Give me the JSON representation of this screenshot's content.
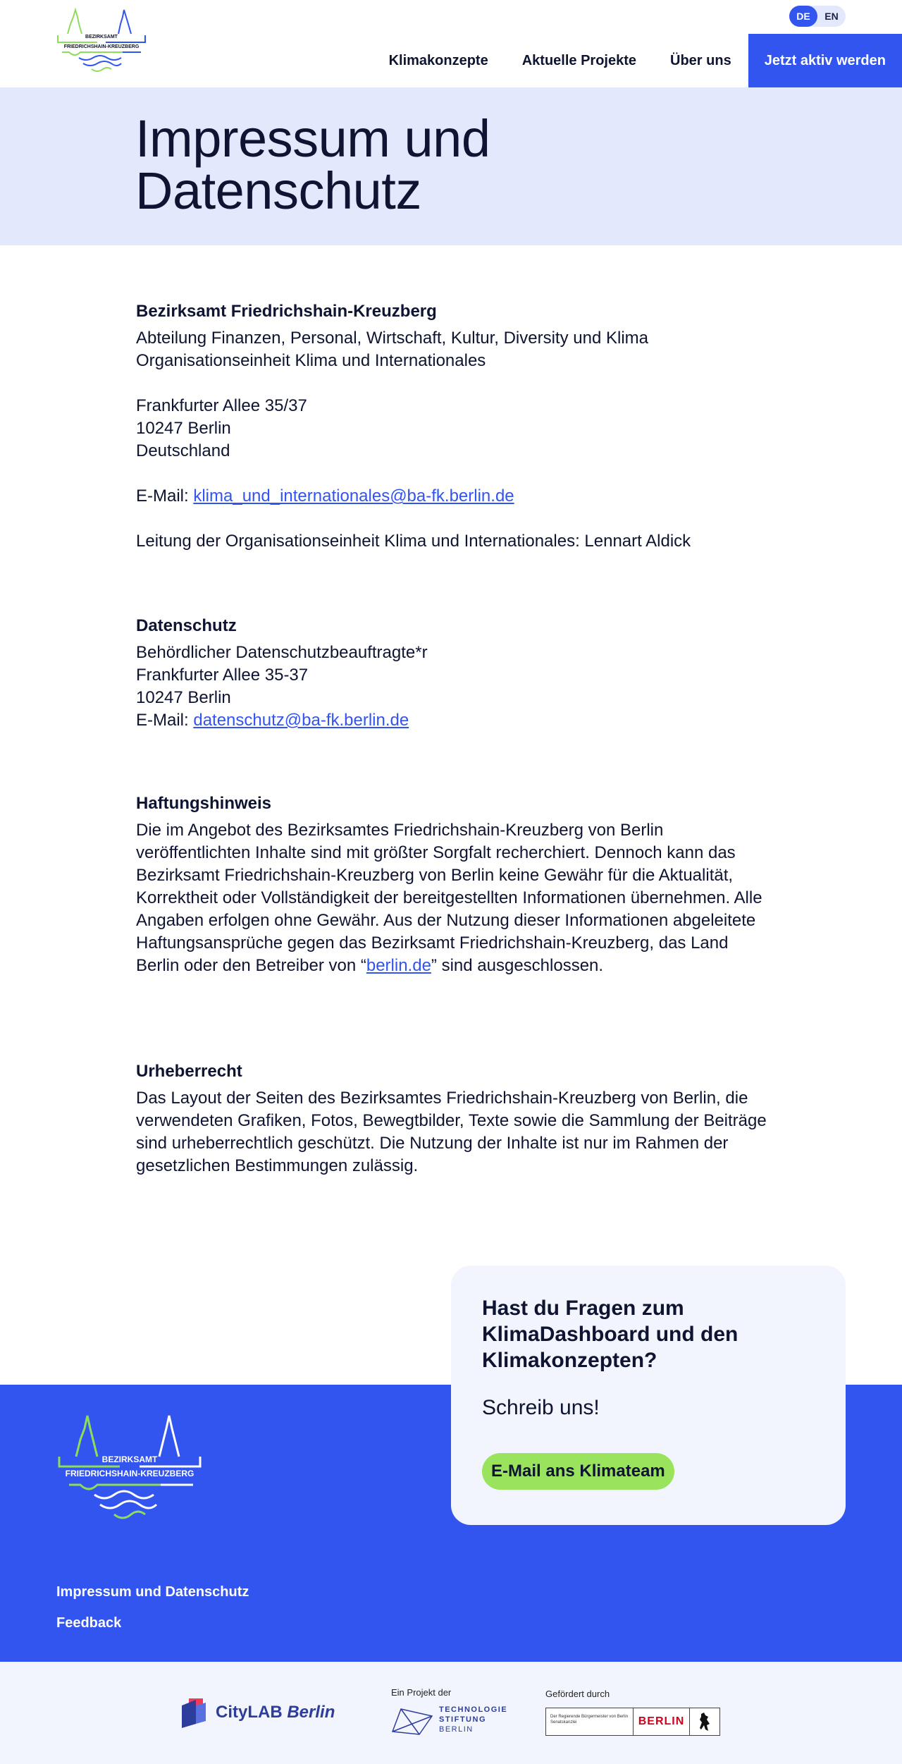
{
  "header": {
    "logo_alt_line1": "BEZIRKSAMT",
    "logo_alt_line2": "FRIEDRICHSHAIN-KREUZBERG",
    "lang": [
      "DE",
      "EN"
    ],
    "nav": [
      "Klimakonzepte",
      "Aktuelle Projekte",
      "Über uns"
    ],
    "cta": "Jetzt aktiv werden"
  },
  "page_title": "Impressum und Datenschutz",
  "impressum": {
    "heading": "Bezirksamt Friedrichshain-Kreuzberg",
    "dept1": "Abteilung Finanzen, Personal, Wirtschaft, Kultur, Diversity und Klima",
    "dept2": "Organisationseinheit Klima und Internationales",
    "street": "Frankfurter Allee 35/37",
    "city": "10247 Berlin",
    "country": "Deutschland",
    "email_label": "E-Mail: ",
    "email": "klima_und_internationales@ba-fk.berlin.de",
    "leitung": "Leitung der Organisationseinheit Klima und Internationales: Lennart Aldick"
  },
  "datenschutz": {
    "heading": "Datenschutz",
    "line1": "Behördlicher Datenschutzbeauftragte*r",
    "line2": "Frankfurter Allee 35-37",
    "line3": "10247 Berlin",
    "email_label": "E-Mail: ",
    "email": "datenschutz@ba-fk.berlin.de"
  },
  "haftung": {
    "heading": "Haftungshinweis",
    "text_before": "Die im Angebot des Bezirksamtes Friedrichshain-Kreuzberg von Berlin veröffentlichten Inhalte sind mit größter Sorgfalt recherchiert. Dennoch kann das Bezirksamt Friedrichshain-Kreuzberg von Berlin keine Gewähr für die Aktualität, Korrektheit oder Vollständigkeit der bereitgestellten Informationen übernehmen. Alle Angaben erfolgen ohne Gewähr. Aus der Nutzung dieser Informationen abgeleitete Haftungsansprüche gegen das Bezirksamt Friedrichshain-Kreuzberg, das Land Berlin oder den Betreiber von “",
    "link": "berlin.de",
    "text_after": "” sind ausgeschlossen."
  },
  "urheber": {
    "heading": "Urheberrecht",
    "text": "Das Layout der Seiten des Bezirksamtes Friedrichshain-Kreuzberg von Berlin, die verwendeten Grafiken, Fotos, Bewegtbilder, Texte sowie die Sammlung der Beiträge sind urheberrechtlich geschützt. Die Nutzung der Inhalte ist nur im Rahmen der gesetzlichen Bestimmungen zulässig."
  },
  "contact_card": {
    "question": "Hast du Fragen zum KlimaDashboard und den Klimakonzepten?",
    "sub": "Schreib uns!",
    "button": "E-Mail ans Klimateam"
  },
  "footer": {
    "links": [
      "Impressum und Datenschutz",
      "Feedback"
    ]
  },
  "partners": {
    "citylab_a": "CityLAB ",
    "citylab_b": "Berlin",
    "tsb_caption": "Ein Projekt der",
    "tsb_words": [
      "TECHNOLOGIE",
      "STIFTUNG",
      "BERLIN"
    ],
    "berlin_caption": "Gefördert durch",
    "berlin_small": "Der Regierende Bürgermeister von Berlin Senatskanzlei",
    "berlin_word": "BERLIN"
  },
  "colors": {
    "primary": "#3254ef",
    "light_band": "#e3e8fc",
    "accent_green": "#9ae35c",
    "text": "#0e1431"
  }
}
